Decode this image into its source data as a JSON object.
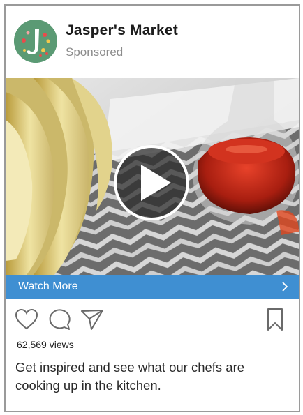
{
  "post": {
    "brand_name": "Jasper's Market",
    "sponsored_label": "Sponsored",
    "cta_label": "Watch More",
    "views": "62,569 views",
    "caption": "Get inspired and see what our chefs are cooking up in the kitchen."
  },
  "icons": {
    "avatar": "jasper-logo-icon",
    "play": "play-icon",
    "chevron": "chevron-right-icon",
    "like": "heart-icon",
    "comment": "comment-icon",
    "share": "send-icon",
    "save": "bookmark-icon"
  },
  "colors": {
    "cta_background": "#3f8fd2",
    "avatar_background": "#5b9a74",
    "border": "#9a9a9a"
  }
}
